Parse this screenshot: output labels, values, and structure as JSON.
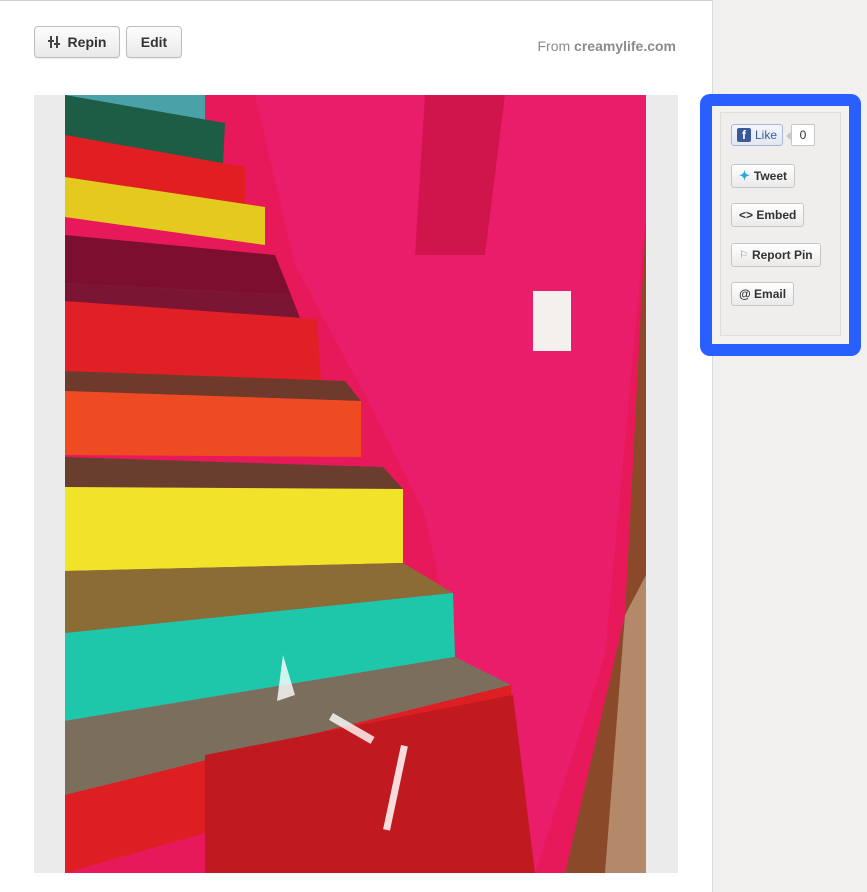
{
  "toolbar": {
    "repin_label": "Repin",
    "edit_label": "Edit"
  },
  "source": {
    "prefix": "From",
    "domain": "creamylife.com"
  },
  "share": {
    "like_label": "Like",
    "like_count": "0",
    "tweet_label": "Tweet",
    "embed_label": "<> Embed",
    "report_label": "Report Pin",
    "email_label": "@ Email"
  },
  "icons": {
    "repin": "repin-icon",
    "facebook": "facebook-icon",
    "twitter": "twitter-bird-icon",
    "report": "flag-icon"
  },
  "colors": {
    "highlight_border": "#2a5fff",
    "facebook_blue": "#3b5998",
    "twitter_blue": "#2aa9e0"
  }
}
